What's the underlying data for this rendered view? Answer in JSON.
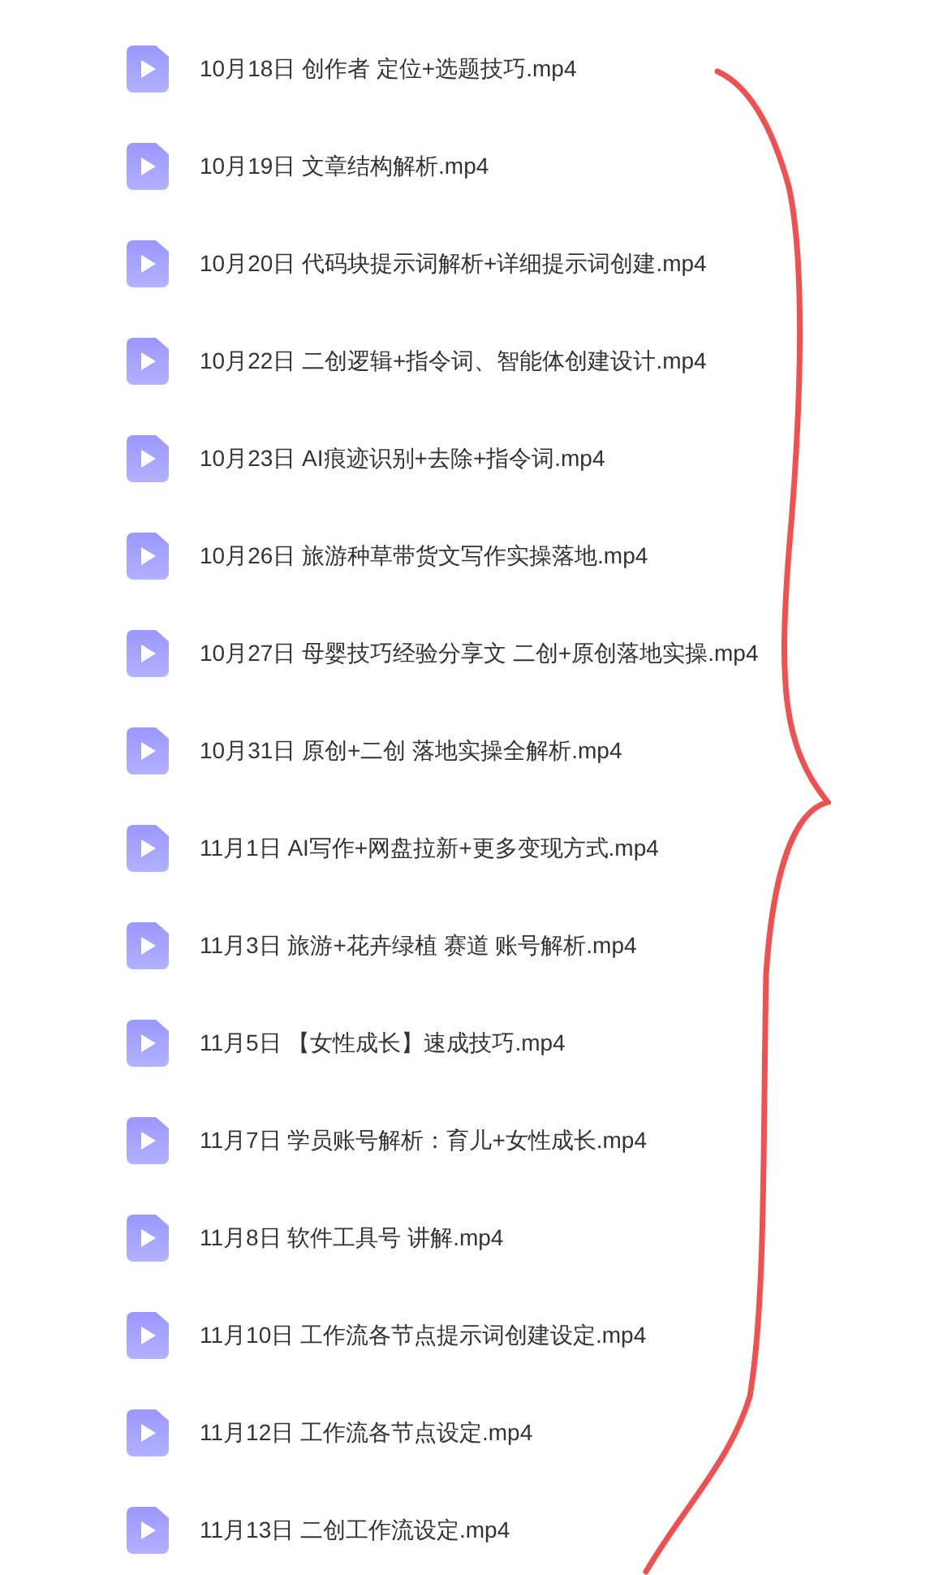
{
  "files": [
    {
      "name": "10月18日 创作者 定位+选题技巧.mp4"
    },
    {
      "name": "10月19日 文章结构解析.mp4"
    },
    {
      "name": "10月20日 代码块提示词解析+详细提示词创建.mp4"
    },
    {
      "name": "10月22日 二创逻辑+指令词、智能体创建设计.mp4"
    },
    {
      "name": "10月23日 AI痕迹识别+去除+指令词.mp4"
    },
    {
      "name": "10月26日 旅游种草带货文写作实操落地.mp4"
    },
    {
      "name": "10月27日 母婴技巧经验分享文 二创+原创落地实操.mp4"
    },
    {
      "name": "10月31日 原创+二创 落地实操全解析.mp4"
    },
    {
      "name": "11月1日 AI写作+网盘拉新+更多变现方式.mp4"
    },
    {
      "name": "11月3日 旅游+花卉绿植 赛道 账号解析.mp4"
    },
    {
      "name": "11月5日 【女性成长】速成技巧.mp4"
    },
    {
      "name": "11月7日 学员账号解析：育儿+女性成长.mp4"
    },
    {
      "name": "11月8日 软件工具号 讲解.mp4"
    },
    {
      "name": "11月10日 工作流各节点提示词创建设定.mp4"
    },
    {
      "name": "11月12日 工作流各节点设定.mp4"
    },
    {
      "name": "11月13日 二创工作流设定.mp4"
    }
  ]
}
